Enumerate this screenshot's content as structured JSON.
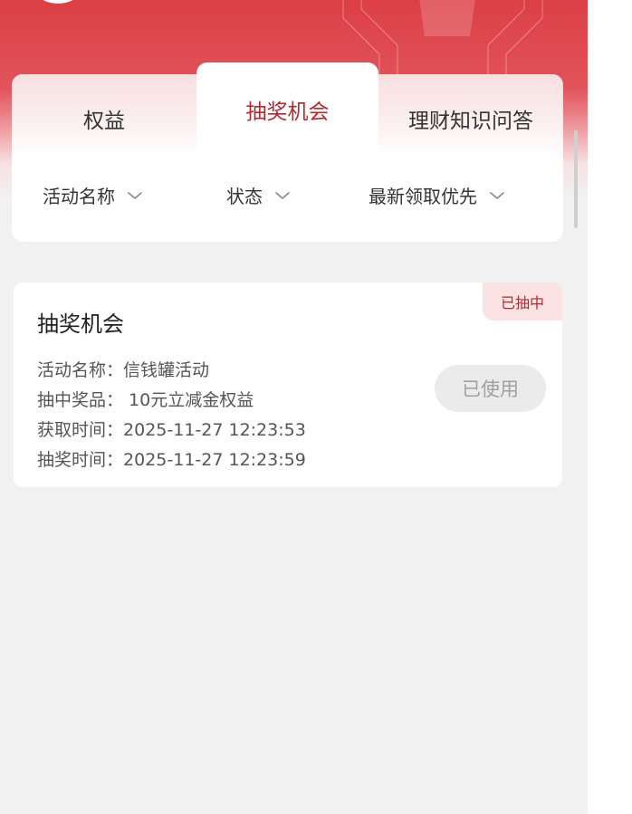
{
  "tabs": [
    {
      "label": "权益",
      "active": false
    },
    {
      "label": "抽奖机会",
      "active": true
    },
    {
      "label": "理财知识问答",
      "active": false
    }
  ],
  "filters": [
    {
      "label": "活动名称",
      "icon": "chevron-down-icon"
    },
    {
      "label": "状态",
      "icon": "chevron-down-icon"
    },
    {
      "label": "最新领取优先",
      "icon": "chevron-down-icon"
    }
  ],
  "record": {
    "title": "抽奖机会",
    "status_badge": "已抽中",
    "rows": [
      {
        "label": "活动名称：",
        "value": "信钱罐活动"
      },
      {
        "label": "抽中奖品：",
        "value": " 10元立减金权益"
      },
      {
        "label": "获取时间：",
        "value": "2025-11-27 12:23:53"
      },
      {
        "label": "抽奖时间：",
        "value": "2025-11-27 12:23:59"
      }
    ],
    "action_label": "已使用"
  },
  "colors": {
    "accent": "#b22a2f",
    "header_red": "#dc3f46",
    "badge_bg": "#fbe3e3",
    "page_bg": "#f1f1f1"
  }
}
